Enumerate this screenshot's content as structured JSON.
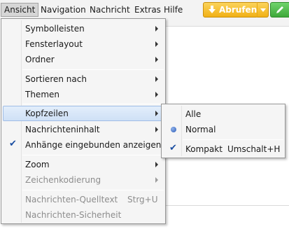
{
  "menubar": {
    "items": [
      {
        "label": "Ansicht"
      },
      {
        "label": "Navigation"
      },
      {
        "label": "Nachricht"
      },
      {
        "label": "Extras"
      },
      {
        "label": "Hilfe"
      }
    ],
    "get_mail_label": "Abrufen",
    "get_mail_icon": "download-arrow-icon",
    "write_icon": "pencil-icon"
  },
  "view_menu": {
    "items": [
      {
        "label": "Symbolleisten",
        "submenu": true
      },
      {
        "label": "Fensterlayout",
        "submenu": true
      },
      {
        "label": "Ordner",
        "submenu": true
      },
      {
        "label": "Sortieren nach",
        "submenu": true
      },
      {
        "label": "Themen",
        "submenu": true
      },
      {
        "label": "Kopfzeilen",
        "submenu": true,
        "highlighted": true
      },
      {
        "label": "Nachrichteninhalt",
        "submenu": true
      },
      {
        "label": "Anhänge eingebunden anzeigen",
        "checked": true
      },
      {
        "label": "Zoom",
        "submenu": true
      },
      {
        "label": "Zeichenkodierung",
        "submenu": true,
        "disabled": true
      },
      {
        "label": "Nachrichten-Quelltext",
        "shortcut": "Strg+U",
        "disabled": true
      },
      {
        "label": "Nachrichten-Sicherheit",
        "disabled": true
      }
    ]
  },
  "headers_submenu": {
    "items": [
      {
        "label": "Alle",
        "selected": false
      },
      {
        "label": "Normal",
        "selected": true
      },
      {
        "label": "Kompakt",
        "shortcut": "Umschalt+H",
        "checked": true
      }
    ]
  },
  "colors": {
    "accent_button": "#f1b116",
    "write_button": "#3ea83a",
    "check_mark": "#1b4fa2"
  }
}
